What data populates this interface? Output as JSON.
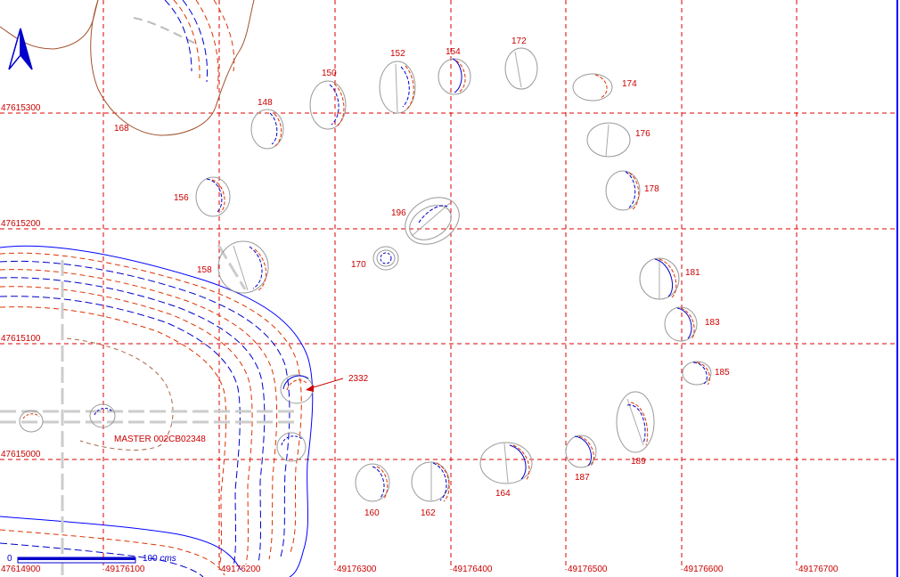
{
  "map": {
    "north_arrow": "north-arrow-icon",
    "grid": {
      "easting_labels": [
        "49176100",
        "49176200",
        "49176300",
        "49176400",
        "49176500",
        "49176600",
        "49176700"
      ],
      "northing_labels": [
        "47615300",
        "47615200",
        "47615100",
        "47615000",
        "47614900"
      ]
    },
    "features": [
      {
        "id": "148",
        "label": "148"
      },
      {
        "id": "150",
        "label": "150"
      },
      {
        "id": "152",
        "label": "152"
      },
      {
        "id": "154",
        "label": "154"
      },
      {
        "id": "172",
        "label": "172"
      },
      {
        "id": "174",
        "label": "174"
      },
      {
        "id": "176",
        "label": "176"
      },
      {
        "id": "178",
        "label": "178"
      },
      {
        "id": "156",
        "label": "156"
      },
      {
        "id": "196",
        "label": "196"
      },
      {
        "id": "158",
        "label": "158"
      },
      {
        "id": "170",
        "label": "170"
      },
      {
        "id": "181",
        "label": "181"
      },
      {
        "id": "183",
        "label": "183"
      },
      {
        "id": "185",
        "label": "185"
      },
      {
        "id": "2332",
        "label": "2332"
      },
      {
        "id": "189",
        "label": "189"
      },
      {
        "id": "187",
        "label": "187"
      },
      {
        "id": "164",
        "label": "164"
      },
      {
        "id": "162",
        "label": "162"
      },
      {
        "id": "160",
        "label": "160"
      },
      {
        "id": "168",
        "label": "168"
      }
    ],
    "master_label": "MASTER 002CB02348",
    "scale": {
      "start": "0",
      "end": "100",
      "unit": "cms"
    },
    "colors": {
      "grid": "#dd0000",
      "feature_outline": "#999999",
      "contour_blue": "#0000cc",
      "contour_red": "#dd3300",
      "brown_line": "#a0522d",
      "edge": "#0000ff"
    }
  }
}
